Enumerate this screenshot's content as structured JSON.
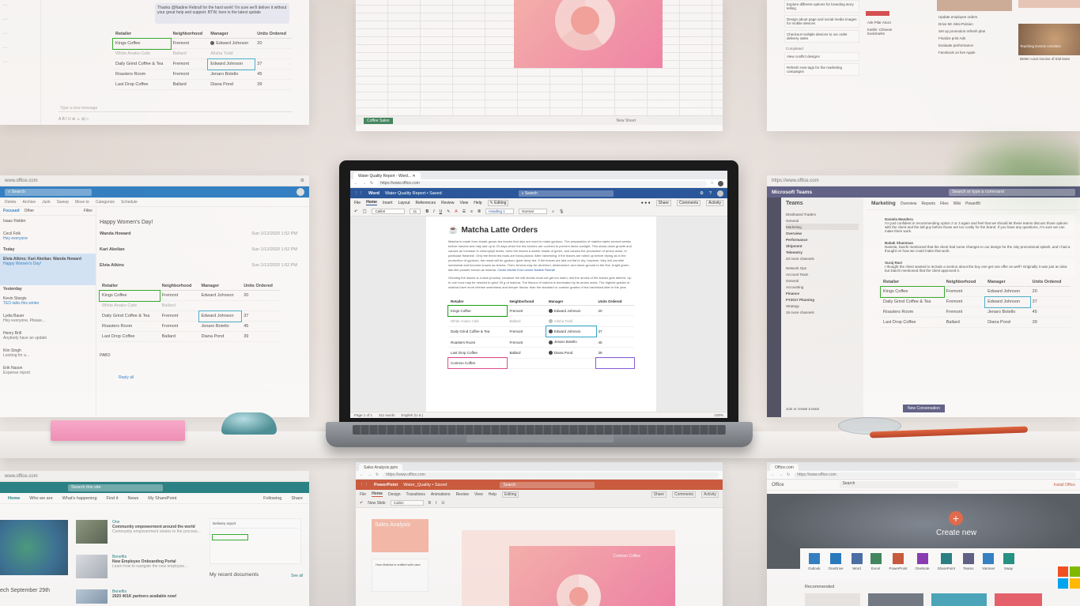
{
  "word": {
    "tab_title": "Water Quality Report - Word...",
    "url": "https://www.office.com",
    "app_name": "Word",
    "doc_name": "Water Quality Report • Saved",
    "search_placeholder": "Search",
    "menu": [
      "File",
      "Home",
      "Insert",
      "Layout",
      "References",
      "Review",
      "View",
      "Help"
    ],
    "editing_label": "Editing",
    "share_label": "Share",
    "comments_label": "Comments",
    "activity_label": "Activity",
    "font": "Calibri",
    "font_size": "11",
    "style_heading": "Heading 1",
    "style_normal": "Normal",
    "doc_title": "Matcha Latte Orders",
    "para1": "Matcha is made from shade-grown tea leaves that also are used to make gyokuro. The preparation of matcha starts several weeks before harvest and may last up to 20 days when the tea bushes are covered to prevent direct sunlight. This slows down growth and causes an increase in chlorophyll levels, turns the leaves a darker shade of green, and causes the production of amino acids, in particular theanine. Only the finest tea buds are hand-picked. After harvesting, if the leaves are rolled up before drying as in the production of gyokuro, the result will be gyokuro (jade dew) tea. If the leaves are laid out flat to dry, however, they will crumble somewhat and become known as tencha. Then, tencha may be deveined, destemmed, and stone-ground to the fine, bright green, talc-like powder known as matcha.",
    "mentions": [
      "Cecile Michel",
      "Eva Lamos",
      "Nadine Rebrall"
    ],
    "para2": "Grinding the leaves is a slow process, because the mill stones must not get too warm, lest the aroma of the leaves gets altered. Up to one hour may be needed to grind 30 g of matcha. The flavour of matcha is dominated by its amino acids. The highest grades of matcha have more intense sweetness and deeper flavour than the standard or coarser grades of tea harvested later in the year.",
    "table": {
      "headers": [
        "Retailer",
        "Neighborhood",
        "Manager",
        "Units Ordered"
      ],
      "rows": [
        [
          "Kings Coffee",
          "Fremont",
          "Edward Johnson",
          "20"
        ],
        [
          "White Anako Cafe",
          "Ballard",
          "Alisha Todd",
          ""
        ],
        [
          "Daily Grind Coffee & Tea",
          "Fremont",
          "Edward Johnson",
          "37"
        ],
        [
          "Roasters Room",
          "Fremont",
          "Jenaro Botello",
          "45"
        ],
        [
          "Last Drop Coffee",
          "Ballard",
          "Diana Pond",
          "39"
        ],
        [
          "Contoso Coffee",
          "",
          "",
          ""
        ]
      ]
    },
    "status": [
      "Page 1 of 1",
      "311 words",
      "English (U.S.)"
    ],
    "zoom": "100%"
  },
  "outlook_top": {
    "message": "Thanks @Nadine Rebrall for the hard work! I'm sure we'll deliver it without your great help and support. BTW, here is the latest update",
    "reply_placeholder": "Type a new message",
    "table": {
      "headers": [
        "Retailer",
        "Neighborhood",
        "Manager",
        "Units Ordered"
      ],
      "rows": [
        [
          "Kings Coffee",
          "Fremont",
          "",
          ""
        ],
        [
          "White Anako Cafe",
          "Ballard",
          "Alisha Todd",
          ""
        ],
        [
          "Daily Grind Coffee & Tea",
          "Fremont",
          "Edward Johnson",
          "37"
        ],
        [
          "Roasters Room",
          "Fremont",
          "Jenaro Botello",
          "45"
        ],
        [
          "Last Drop Coffee",
          "Ballard",
          "Diana Pond",
          "39"
        ]
      ]
    }
  },
  "excel": {
    "sheet_tab": "Coffee Sales",
    "new_sheet": "New Sheet"
  },
  "outlook": {
    "url": "www.office.com",
    "search_placeholder": "Search",
    "toolbar": [
      "Delete",
      "Archive",
      "Junk",
      "Sweep",
      "Move to",
      "Categorize",
      "Schedule"
    ],
    "folders_tabs": [
      "Focused",
      "Other"
    ],
    "filter_label": "Filter",
    "subject": "Happy Women's Day!",
    "sections": [
      "Today",
      "Yesterday"
    ],
    "senders": [
      {
        "name": "Isaac Fielder",
        "preview": ""
      },
      {
        "name": "Cecil Folk",
        "preview": "Hey everyone"
      },
      {
        "name": "Elvia Atkins; Kari Akelian; Wanda Howard",
        "preview": "Happy Women's Day!"
      },
      {
        "name": "Kevin Sturgis",
        "preview": "TED talks this winter"
      },
      {
        "name": "Lydia Bauer",
        "preview": "Hey everyone, Please..."
      },
      {
        "name": "Henry Brill",
        "preview": "Anybody have an update"
      },
      {
        "name": "Kim Singh",
        "preview": "Looking for a..."
      },
      {
        "name": "Erik Nason",
        "preview": "Expense report"
      }
    ],
    "thread": [
      {
        "name": "Wanda Howard",
        "text": "Hi, I'm writing to ask...",
        "time": "Sun 1/12/2020 1:52 PM"
      },
      {
        "name": "Kari Akelian",
        "text": "Happy Women's Day!",
        "time": "Sun 1/12/2020 1:52 PM"
      },
      {
        "name": "Elvia Atkins",
        "text": "Happy Women's Day!",
        "time": "Sun 1/12/2020 1:52 PM"
      }
    ],
    "table_rows": [
      [
        "Kings Coffee",
        "Fremont",
        "Edward Johnson",
        "20"
      ],
      [
        "White Anako Cafe",
        "Ballard",
        "",
        ""
      ],
      [
        "Daily Grind Coffee & Tea",
        "Fremont",
        "Edward Johnson",
        "37"
      ],
      [
        "Roasters Room",
        "Fremont",
        "Jenaro Botello",
        "45"
      ],
      [
        "Last Drop Coffee",
        "Ballard",
        "Diana Pond",
        "39"
      ]
    ],
    "sign": "PABO",
    "reply_all": "Reply all"
  },
  "teams": {
    "app_name": "Microsoft Teams",
    "search_placeholder": "Search or type a command",
    "left_title": "Teams",
    "team_items": [
      "Distributed Traders",
      "General",
      "Marketing",
      "Overview",
      "Performance",
      "Shipment",
      "Telemetry",
      "20 more channels",
      "Network Ops",
      "Account Team",
      "General",
      "Accounting",
      "Finance",
      "FY2017 Planning",
      "Strategy",
      "15 more channels"
    ],
    "channel": "Marketing",
    "channel_tabs": [
      "Overview",
      "Reports",
      "Files",
      "Wiki",
      "PowerBI"
    ],
    "messages": [
      {
        "name": "Daniela Mandera",
        "text": "I'm just confident in recommending option 2 or 3 again and feel that we should let these teams discuss those options with the client and the tall guy before those are too costly for the brand. If you have any questions, I'm sure we can make them work."
      },
      {
        "name": "Babak Shammas",
        "text": "Daniela, Daichi mentioned that the client had some changes to our design for the July promotional splash, and I had a thought on how we could make that work."
      },
      {
        "name": "Suraj Ravi",
        "text": "I thought the client wanted to include a section about the buy one get one offer as well? Originally it was just an idea but Daichi mentioned that the client approved it."
      }
    ],
    "table_rows": [
      [
        "Kings Coffee",
        "Fremont",
        "Edward Johnson",
        "20"
      ],
      [
        "Daily Grind Coffee & Tea",
        "Fremont",
        "Edward Johnson",
        "37"
      ],
      [
        "Roasters Room",
        "Fremont",
        "Jenaro Botello",
        "45"
      ],
      [
        "Last Drop Coffee",
        "Ballard",
        "Diana Pond",
        "39"
      ]
    ],
    "new_conversation": "New Conversation",
    "join_team": "Join or create a team"
  },
  "planner": {
    "tasks": [
      "Explore different options for branding story telling",
      "Design about page and social media images for mobile devices",
      "Checkout multiple devices to our order delivery sales",
      "View conflict designs",
      "Refresh new tags for the marketing campaigns",
      "Ask Pilar Alcon",
      "Kaitlin: Chinese bookmarks",
      "Update employee orders",
      "Drive Mr. Mini-Pulsion",
      "Set up promotion refresh plan",
      "Finalize print Ads",
      "Evaluate performance",
      "Facebook on live Apple",
      "Better court invoice of trial team"
    ],
    "labels": [
      "Completed",
      "Teaching Events Activities"
    ]
  },
  "sharepoint": {
    "url": "www.office.com",
    "search_placeholder": "Search this site",
    "nav": [
      "Home",
      "Who we are",
      "What's happening",
      "Find it",
      "News",
      "My SharePoint"
    ],
    "following": "Following",
    "share": "Share",
    "date": "ech September 29th",
    "news": [
      {
        "tag": "One",
        "title": "Community empowerment around the world",
        "body": "Community empowerment relates to the process..."
      },
      {
        "tag": "Benefits",
        "title": "New Employee Onboarding Portal",
        "body": "Learn how to navigate the new employee..."
      },
      {
        "tag": "Benefits",
        "title": "2020 401K partners available now!",
        "body": ""
      }
    ],
    "docs_title": "My recent documents",
    "see_all": "See all",
    "report_title": "Delivery report"
  },
  "powerpoint": {
    "tab_title": "Sales Analysis.pptx",
    "url": "https://www.office.com",
    "app_name": "PowerPoint",
    "doc_name": "Water_Quality • Saved",
    "search_placeholder": "Search",
    "menu": [
      "File",
      "Home",
      "Design",
      "Transitions",
      "Animations",
      "Review",
      "View",
      "Help"
    ],
    "editing_label": "Editing",
    "share_label": "Share",
    "comments_label": "Comments",
    "activity_label": "Activity",
    "thumb1": "Sales Analysis",
    "slide_caption": "Contoso Coffee",
    "thumb2": "How Matcha is crafted with care"
  },
  "office_home": {
    "url": "https://www.office.com",
    "title": "Office",
    "search_placeholder": "Search",
    "install": "Install Office",
    "create_new": "Create new",
    "apps": [
      "Outlook",
      "OneDrive",
      "Word",
      "Excel",
      "PowerPoint",
      "OneNote",
      "SharePoint",
      "Teams",
      "Yammer",
      "Sway"
    ],
    "recommended": "Recommended"
  },
  "colors": {
    "word_blue": "#2b579a",
    "outlook_blue": "#0f6cbd",
    "teams_purple": "#464775",
    "powerpoint_red": "#c43e1c",
    "sharepoint_teal": "#036c70",
    "excel_green": "#217346",
    "selection_green": "#13a10e",
    "selection_blue": "#2fa7c7",
    "selection_pink": "#e04b8b"
  }
}
